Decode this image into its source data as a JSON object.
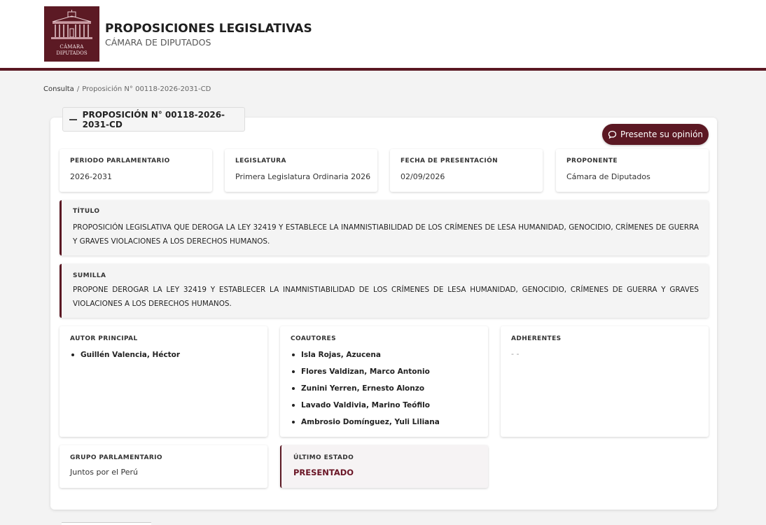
{
  "header": {
    "logo_text_1": "CÁMARA",
    "logo_text_2": "DIPUTADOS",
    "title": "PROPOSICIONES LEGISLATIVAS",
    "subtitle": "CÁMARA DE DIPUTADOS"
  },
  "breadcrumb": {
    "link": "Consulta",
    "separator": "/",
    "current": "Proposición N° 00118-2026-2031-CD"
  },
  "panel": {
    "legend": "PROPOSICIÓN N° 00118-2026-2031-CD",
    "opinion_button": "Presente su opinión"
  },
  "info": [
    {
      "label": "PERIODO PARLAMENTARIO",
      "value": "2026-2031"
    },
    {
      "label": "LEGISLATURA",
      "value": "Primera Legislatura Ordinaria 2026"
    },
    {
      "label": "FECHA DE PRESENTACIÓN",
      "value": "02/09/2026"
    },
    {
      "label": "PROPONENTE",
      "value": "Cámara de Diputados"
    }
  ],
  "titulo": {
    "label": "TÍTULO",
    "text": "PROPOSICIÓN LEGISLATIVA QUE DEROGA LA LEY 32419 Y ESTABLECE LA INAMNISTIABILIDAD DE LOS CRÍMENES DE LESA HUMANIDAD, GENOCIDIO, CRÍMENES DE GUERRA Y GRAVES VIOLACIONES A LOS DERECHOS HUMANOS."
  },
  "sumilla": {
    "label": "SUMILLA",
    "text": "PROPONE DEROGAR LA LEY 32419 Y ESTABLECER LA INAMNISTIABILIDAD DE LOS CRÍMENES DE LESA HUMANIDAD, GENOCIDIO, CRÍMENES DE GUERRA Y GRAVES VIOLACIONES A LOS DERECHOS HUMANOS."
  },
  "autor": {
    "label": "AUTOR PRINCIPAL",
    "names": [
      "Guillén Valencia, Héctor"
    ]
  },
  "coautores": {
    "label": "COAUTORES",
    "names": [
      "Isla Rojas, Azucena",
      "Flores Valdizan, Marco Antonio",
      "Zunini Yerren, Ernesto Alonzo",
      "Lavado Valdivia, Marino Teófilo",
      "Ambrosio Domínguez, Yuli Liliana"
    ]
  },
  "adherentes": {
    "label": "ADHERENTES",
    "value": "- -"
  },
  "grupo": {
    "label": "GRUPO PARLAMENTARIO",
    "value": "Juntos por el Perú"
  },
  "estado": {
    "label": "ÚLTIMO ESTADO",
    "value": "PRESENTADO"
  },
  "colors": {
    "brand": "#5b1823",
    "estado_text": "#6a1525"
  }
}
